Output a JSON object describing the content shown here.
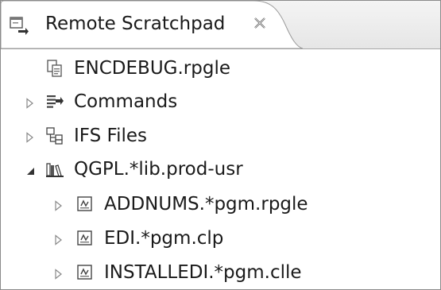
{
  "tab": {
    "title": "Remote Scratchpad",
    "icon": "remote-scratchpad-icon",
    "close_icon": "close-icon"
  },
  "tree": {
    "items": [
      {
        "label": "ENCDEBUG.rpgle",
        "icon": "file-copy-icon",
        "expander": "none",
        "level": 0
      },
      {
        "label": "Commands",
        "icon": "commands-icon",
        "expander": "collapsed",
        "level": 0
      },
      {
        "label": "IFS Files",
        "icon": "ifs-files-icon",
        "expander": "collapsed",
        "level": 0
      },
      {
        "label": "QGPL.*lib.prod-usr",
        "icon": "library-icon",
        "expander": "expanded",
        "level": 0
      },
      {
        "label": "ADDNUMS.*pgm.rpgle",
        "icon": "program-icon",
        "expander": "collapsed",
        "level": 1
      },
      {
        "label": "EDI.*pgm.clp",
        "icon": "program-icon",
        "expander": "collapsed",
        "level": 1
      },
      {
        "label": "INSTALLEDI.*pgm.clle",
        "icon": "program-icon",
        "expander": "collapsed",
        "level": 1
      }
    ]
  }
}
